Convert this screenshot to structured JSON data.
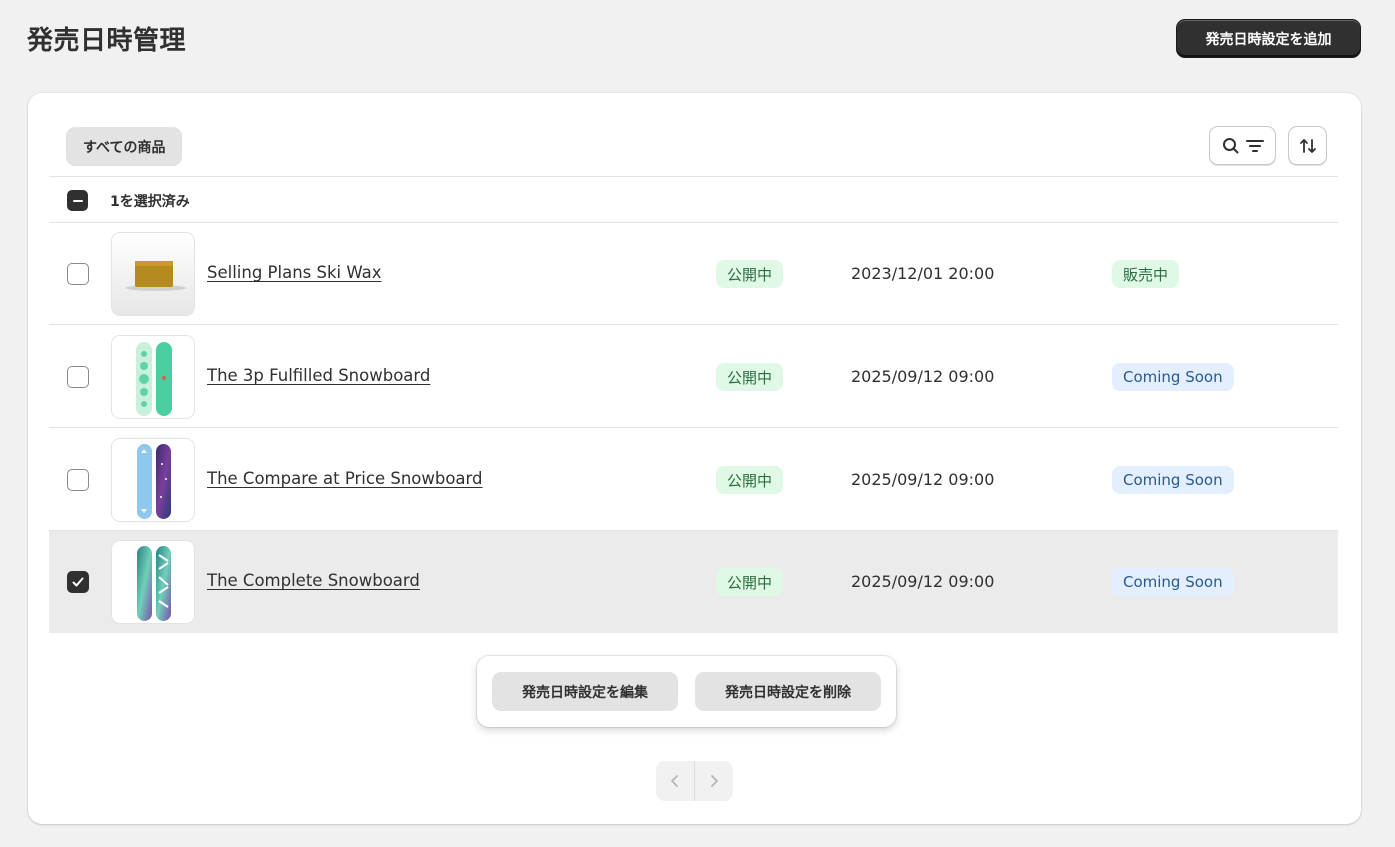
{
  "header": {
    "title": "発売日時管理",
    "add_button": "発売日時設定を追加"
  },
  "toolbar": {
    "tab_all": "すべての商品",
    "search_icon": "search-icon",
    "filter_icon": "filter-icon",
    "sort_icon": "sort-icon"
  },
  "selection": {
    "label": "1を選択済み"
  },
  "table": {
    "rows": [
      {
        "name": "Selling Plans Ski Wax",
        "status": "公開中",
        "datetime": "2023/12/01 20:00",
        "sale_status": "販売中",
        "checked": false
      },
      {
        "name": "The 3p Fulfilled Snowboard",
        "status": "公開中",
        "datetime": "2025/09/12 09:00",
        "sale_status": "Coming Soon",
        "checked": false
      },
      {
        "name": "The Compare at Price Snowboard",
        "status": "公開中",
        "datetime": "2025/09/12 09:00",
        "sale_status": "Coming Soon",
        "checked": false
      },
      {
        "name": "The Complete Snowboard",
        "status": "公開中",
        "datetime": "2025/09/12 09:00",
        "sale_status": "Coming Soon",
        "checked": true
      }
    ]
  },
  "bulk_actions": {
    "edit": "発売日時設定を編集",
    "delete": "発売日時設定を削除"
  },
  "pagination": {
    "prev_icon": "chevron-left-icon",
    "next_icon": "chevron-right-icon"
  },
  "colors": {
    "primary": "#303030",
    "published_bg": "#dff9e6",
    "coming_soon_bg": "#e3efff"
  }
}
